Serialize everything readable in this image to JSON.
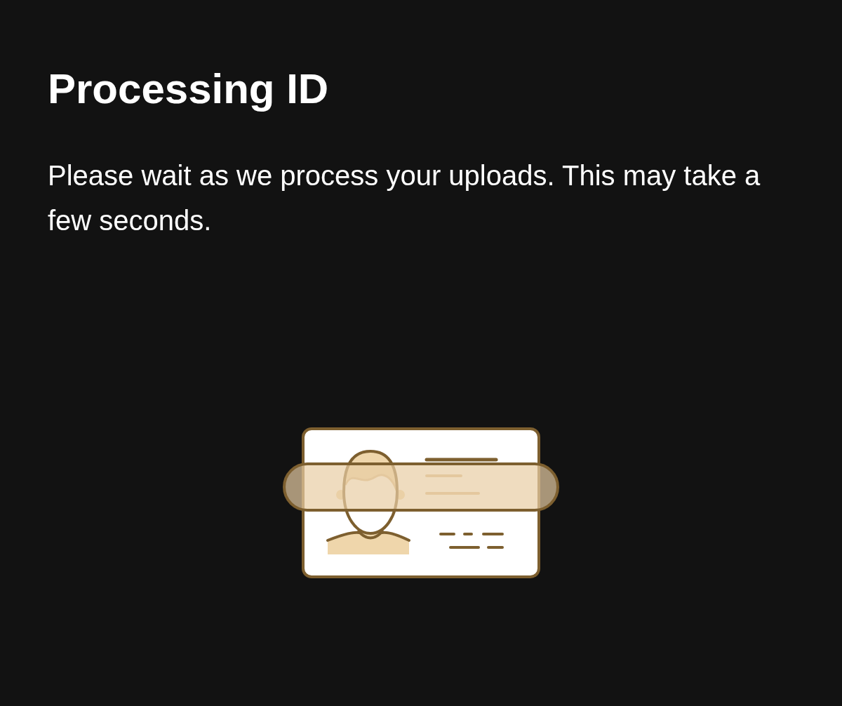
{
  "title": "Processing ID",
  "message": "Please wait as we process your uploads. This may take a few seconds."
}
